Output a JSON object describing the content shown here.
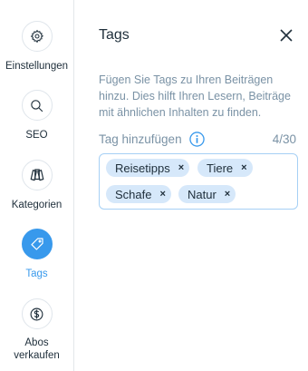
{
  "nav": {
    "settings": {
      "label": "Einstellungen",
      "icon": "gear-icon"
    },
    "seo": {
      "label": "SEO",
      "icon": "search-icon"
    },
    "categories": {
      "label": "Kategorien",
      "icon": "cards-icon"
    },
    "tags": {
      "label": "Tags",
      "icon": "tag-icon"
    },
    "subscriptions": {
      "label": "Abos verkaufen",
      "icon": "dollar-coin-icon"
    }
  },
  "panel": {
    "title": "Tags",
    "description": "Fügen Sie Tags zu Ihren Beiträgen hinzu. Dies hilft Ihren Lesern, Beiträge mit ähnlichen Inhalten zu finden.",
    "field_label": "Tag hinzufügen",
    "counter": "4/30",
    "tags": [
      "Reisetipps",
      "Tiere",
      "Schafe",
      "Natur"
    ],
    "remove_glyph": "×"
  },
  "colors": {
    "accent": "#3899ec",
    "tag_bg": "#d6e8fa",
    "muted_text": "#7a92a5"
  }
}
